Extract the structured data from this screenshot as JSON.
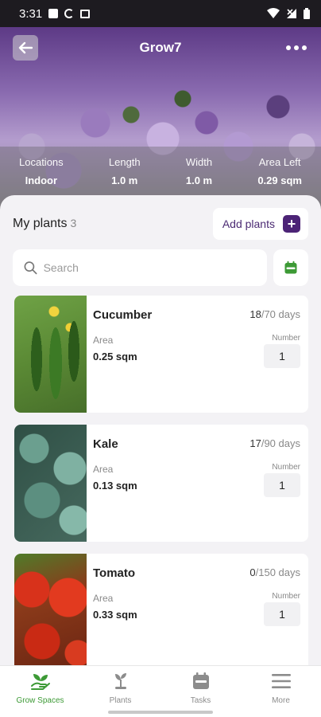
{
  "status_bar": {
    "time": "3:31"
  },
  "header": {
    "title": "Grow7"
  },
  "stats": [
    {
      "label": "Locations",
      "value": "Indoor"
    },
    {
      "label": "Length",
      "value": "1.0 m"
    },
    {
      "label": "Width",
      "value": "1.0 m"
    },
    {
      "label": "Area Left",
      "value": "0.29 sqm"
    }
  ],
  "panel": {
    "title": "My plants",
    "count": "3",
    "add_label": "Add plants",
    "search_placeholder": "Search"
  },
  "plants": [
    {
      "name": "Cucumber",
      "days_current": "18",
      "days_total": "/70 days",
      "area_label": "Area",
      "area_value": "0.25 sqm",
      "number_label": "Number",
      "number_value": "1"
    },
    {
      "name": "Kale",
      "days_current": "17",
      "days_total": "/90 days",
      "area_label": "Area",
      "area_value": "0.13 sqm",
      "number_label": "Number",
      "number_value": "1"
    },
    {
      "name": "Tomato",
      "days_current": "0",
      "days_total": "/150 days",
      "area_label": "Area",
      "area_value": "0.33 sqm",
      "number_label": "Number",
      "number_value": "1"
    }
  ],
  "nav": [
    {
      "label": "Grow Spaces",
      "icon": "hand-sprout-icon",
      "active": true
    },
    {
      "label": "Plants",
      "icon": "plant-icon",
      "active": false
    },
    {
      "label": "Tasks",
      "icon": "calendar-icon",
      "active": false
    },
    {
      "label": "More",
      "icon": "menu-icon",
      "active": false
    }
  ],
  "colors": {
    "accent_purple": "#4c2376",
    "accent_green": "#3d9a36"
  }
}
